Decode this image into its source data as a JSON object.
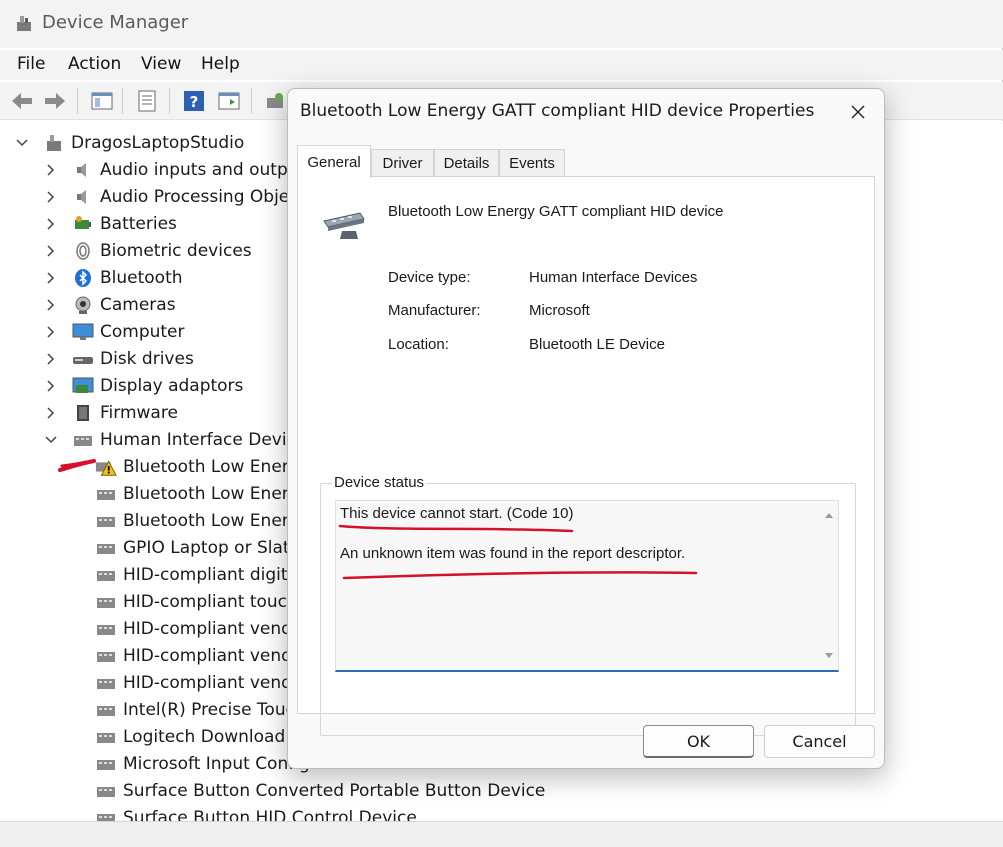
{
  "window": {
    "title": "Device Manager"
  },
  "menu": [
    "File",
    "Action",
    "View",
    "Help"
  ],
  "tree": {
    "root": "DragosLaptopStudio",
    "categories": [
      "Audio inputs and outputs",
      "Audio Processing Objects",
      "Batteries",
      "Biometric devices",
      "Bluetooth",
      "Cameras",
      "Computer",
      "Disk drives",
      "Display adaptors",
      "Firmware",
      "Human Interface Devices"
    ],
    "hid_children": [
      "Bluetooth Low Energy GATT compliant HID device",
      "Bluetooth Low Energy GATT compliant HID device",
      "Bluetooth Low Energy GATT compliant HID device",
      "GPIO Laptop or Slate Indicator Driver",
      "HID-compliant digitizer",
      "HID-compliant touch pad",
      "HID-compliant vendor-defined device",
      "HID-compliant vendor-defined device",
      "HID-compliant vendor-defined device",
      "Intel(R) Precise Touch Device",
      "Logitech Download Assistant",
      "Microsoft Input Configuration Device",
      "Surface Button Converted Portable Button Device",
      "Surface Button HID Control Device"
    ]
  },
  "dialog": {
    "title": "Bluetooth Low Energy GATT compliant HID device Properties",
    "tabs": [
      "General",
      "Driver",
      "Details",
      "Events"
    ],
    "active_tab": "General",
    "device_name": "Bluetooth Low Energy GATT compliant HID device",
    "properties": [
      {
        "label": "Device type:",
        "value": "Human Interface Devices"
      },
      {
        "label": "Manufacturer:",
        "value": "Microsoft"
      },
      {
        "label": "Location:",
        "value": "Bluetooth LE Device"
      }
    ],
    "status_group_label": "Device status",
    "status_lines": [
      "This device cannot start. (Code 10)",
      "An unknown item was found in the report descriptor."
    ],
    "ok_label": "OK",
    "cancel_label": "Cancel"
  },
  "colors": {
    "annotation_red": "#d4102a",
    "focus_blue": "#2a6fb3"
  }
}
